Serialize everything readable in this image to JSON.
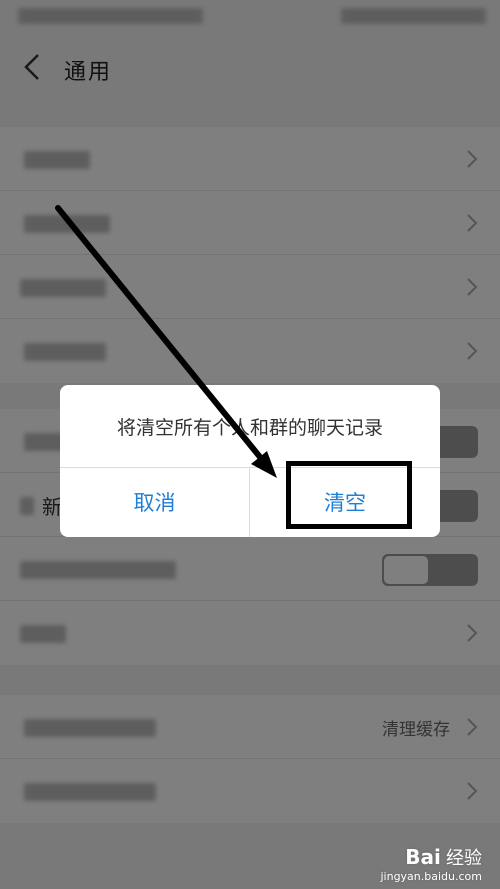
{
  "nav": {
    "title": "通用"
  },
  "group2": {
    "row2_char": "新"
  },
  "group3": {
    "row1_value": "清理缓存"
  },
  "dialog": {
    "message": "将清空所有个人和群的聊天记录",
    "cancel_label": "取消",
    "confirm_label": "清空"
  },
  "watermark": {
    "logo": "Bai",
    "logo2": "经验",
    "url": "jingyan.baidu.com"
  },
  "colors": {
    "accent": "#1f7fd6",
    "annotation": "#000000"
  }
}
